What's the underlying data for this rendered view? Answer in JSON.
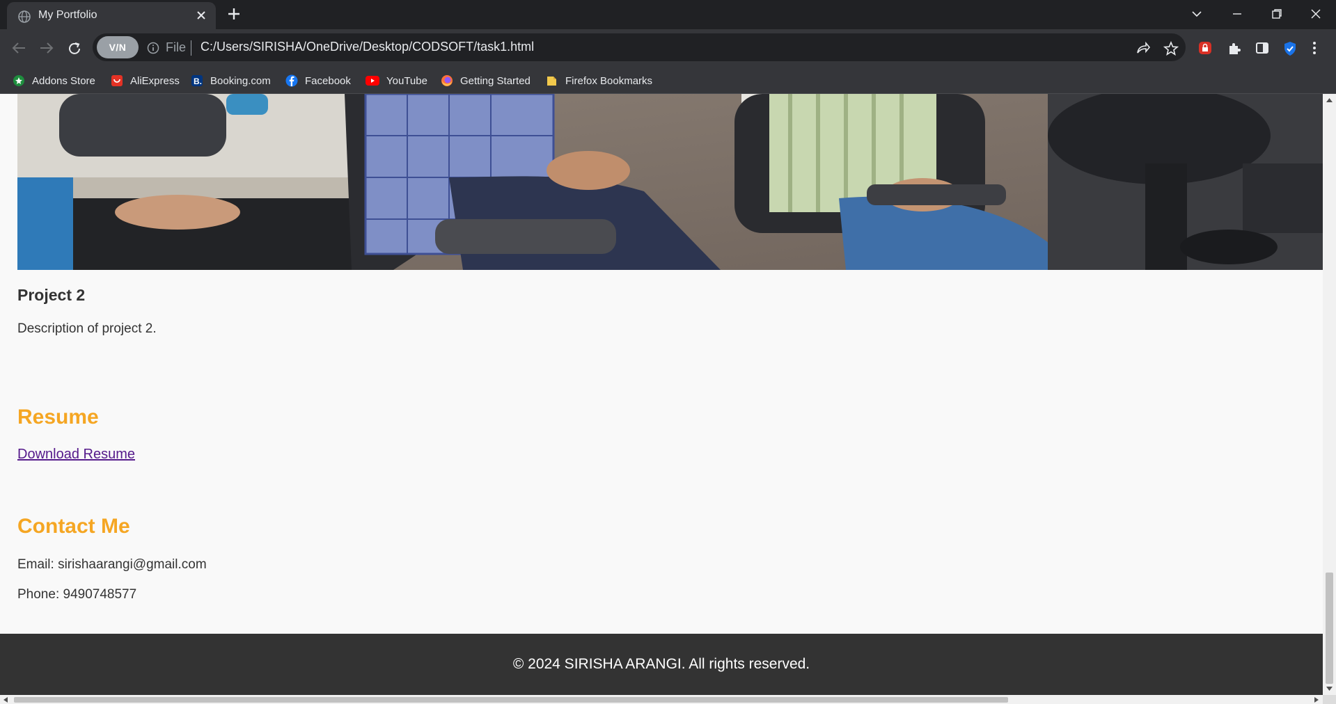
{
  "browser": {
    "tab": {
      "title": "My Portfolio",
      "favicon": "globe-icon",
      "close": "close-icon"
    },
    "new_tab": "plus-icon",
    "window_controls": [
      "tab-search-icon",
      "minimize-icon",
      "restore-icon",
      "close-icon"
    ],
    "vpn_label": "V/N",
    "url_scheme": "File",
    "url": "C:/Users/SIRISHA/OneDrive/Desktop/CODSOFT/task1.html",
    "toolbar_icons": [
      "share-icon",
      "star-icon",
      "extension-red-icon",
      "puzzle-icon",
      "sidepanel-icon",
      "shield-icon",
      "more-icon"
    ],
    "bookmarks": [
      {
        "label": "Addons Store",
        "icon": "addons-icon",
        "color": "#1e8e3e"
      },
      {
        "label": "AliExpress",
        "icon": "aliexpress-icon",
        "color": "#e43225"
      },
      {
        "label": "Booking.com",
        "icon": "booking-icon",
        "color": "#003580"
      },
      {
        "label": "Facebook",
        "icon": "facebook-icon",
        "color": "#1877f2"
      },
      {
        "label": "YouTube",
        "icon": "youtube-icon",
        "color": "#ff0000"
      },
      {
        "label": "Getting Started",
        "icon": "firefox-icon",
        "color": "#ff7139"
      },
      {
        "label": "Firefox Bookmarks",
        "icon": "folder-icon",
        "color": "#f2c94c"
      }
    ]
  },
  "page": {
    "project": {
      "title": "Project 2",
      "description": "Description of project 2."
    },
    "resume": {
      "heading": "Resume",
      "link": "Download Resume"
    },
    "contact": {
      "heading": "Contact Me",
      "email": "Email: sirishaarangi@gmail.com",
      "phone": "Phone: 9490748577"
    },
    "footer": "© 2024 SIRISHA ARANGI. All rights reserved."
  },
  "colors": {
    "accent": "#f5a623",
    "link": "#551a8b",
    "footer_bg": "#333333",
    "chrome_bg": "#35363a"
  }
}
